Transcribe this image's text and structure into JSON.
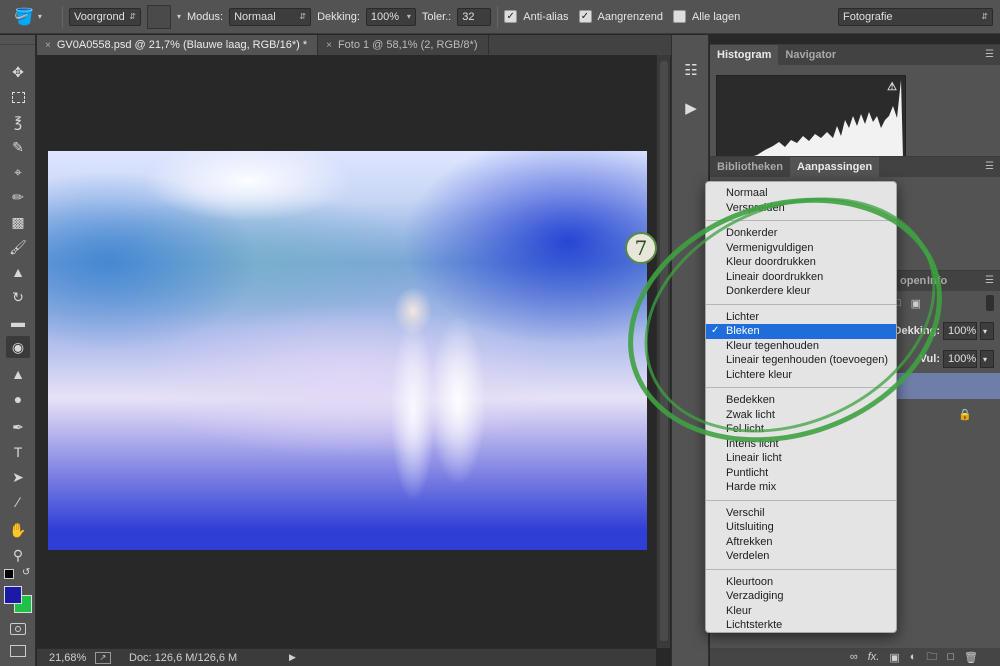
{
  "options_bar": {
    "fill_source": "Voorgrond",
    "mode_label": "Modus:",
    "mode_value": "Normaal",
    "opacity_label": "Dekking:",
    "opacity_value": "100%",
    "tolerance_label": "Toler.:",
    "tolerance_value": "32",
    "anti_alias_label": "Anti-alias",
    "anti_alias_checked": true,
    "contiguous_label": "Aangrenzend",
    "contiguous_checked": true,
    "all_layers_label": "Alle lagen",
    "all_layers_checked": false,
    "workspace": "Fotografie"
  },
  "doc_tabs": [
    {
      "label": "GV0A0558.psd @ 21,7% (Blauwe laag, RGB/16*) *",
      "active": true
    },
    {
      "label": "Foto 1 @ 58,1% (2, RGB/8*)",
      "active": false
    }
  ],
  "tools": [
    "move-tool",
    "marquee-tool",
    "lasso-tool",
    "quick-selection-tool",
    "crop-tool",
    "eyedropper-tool",
    "healing-brush-tool",
    "brush-tool",
    "clone-stamp-tool",
    "history-brush-tool",
    "eraser-tool",
    "paint-bucket-tool",
    "blur-tool",
    "dodge-tool",
    "pen-tool",
    "type-tool",
    "path-selection-tool",
    "line-tool",
    "hand-tool",
    "zoom-tool"
  ],
  "colors": {
    "foreground": "#1a1aa6",
    "background": "#1fc248",
    "menu_highlight": "#1f6ddb",
    "annotation_green": "#3fa142"
  },
  "status": {
    "zoom": "21,68%",
    "doc": "Doc: 126,6 M/126,6 M"
  },
  "panels": {
    "histogram_tabs": [
      "Histogram",
      "Navigator"
    ],
    "adjust_tabs": [
      "Bibliotheken",
      "Aanpassingen"
    ],
    "layers_tabs_partial": [
      "open",
      "Info"
    ],
    "opacity_label": "Dekking:",
    "opacity_value": "100%",
    "fill_label": "Vul:",
    "fill_value": "100%"
  },
  "blend_menu": {
    "groups": [
      [
        "Normaal",
        "Verspreiden"
      ],
      [
        "Donkerder",
        "Vermenigvuldigen",
        "Kleur doordrukken",
        "Lineair doordrukken",
        "Donkerdere kleur"
      ],
      [
        "Lichter",
        "Bleken",
        "Kleur tegenhouden",
        "Lineair tegenhouden (toevoegen)",
        "Lichtere kleur"
      ],
      [
        "Bedekken",
        "Zwak licht",
        "Fel licht",
        "Intens licht",
        "Lineair licht",
        "Puntlicht",
        "Harde mix"
      ],
      [
        "Verschil",
        "Uitsluiting",
        "Aftrekken",
        "Verdelen"
      ],
      [
        "Kleurtoon",
        "Verzadiging",
        "Kleur",
        "Lichtsterkte"
      ]
    ],
    "selected": "Bleken"
  },
  "annotation": {
    "step_number": "7"
  }
}
